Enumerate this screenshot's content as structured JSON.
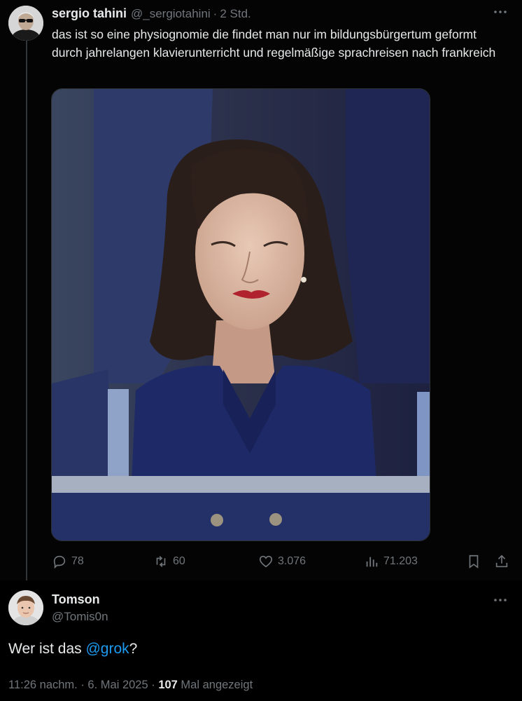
{
  "tweet": {
    "author_name": "sergio tahini",
    "author_handle": "@_sergiotahini",
    "separator": "·",
    "time": "2 Std.",
    "text": "das ist so eine physiognomie die findet man nur im bildungsbürgertum geformt durch jahrelangen klavierunterricht und regelmäßige sprachreisen nach frankreich",
    "stats": {
      "replies": "78",
      "reposts": "60",
      "likes": "3.076",
      "views": "71.203"
    },
    "icons": [
      "more-icon",
      "reply-icon",
      "repost-icon",
      "like-icon",
      "views-icon",
      "bookmark-icon",
      "share-icon"
    ]
  },
  "reply": {
    "author_name": "Tomson",
    "author_handle": "@Tomis0n",
    "text_before": "Wer ist das ",
    "mention": "@grok",
    "text_after": "?",
    "timestamp": "11:26 nachm. · 6. Mai 2025 · ",
    "view_count": "107",
    "view_label": " Mal angezeigt"
  },
  "colors": {
    "background": "#000000",
    "text_primary": "#e7e9ea",
    "text_secondary": "#71767b",
    "link": "#1d9bf0",
    "divider": "#2f3336"
  }
}
